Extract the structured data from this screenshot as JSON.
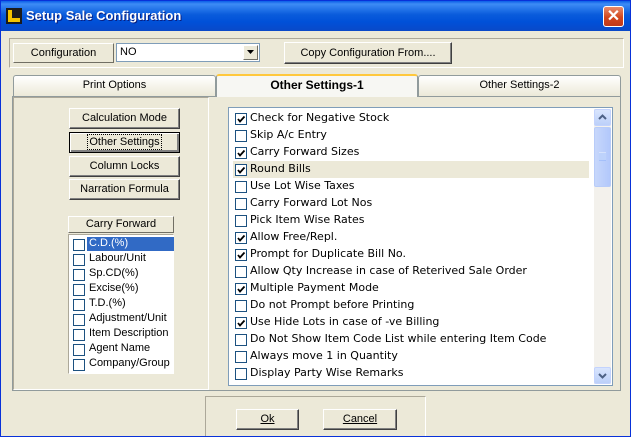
{
  "window": {
    "title": "Setup Sale Configuration"
  },
  "config": {
    "label": "Configuration",
    "value": "NO",
    "copy_button": "Copy Configuration From...."
  },
  "tabs": [
    {
      "label": "Print Options"
    },
    {
      "label": "Other Settings-1"
    },
    {
      "label": "Other Settings-2"
    }
  ],
  "left_buttons": {
    "calculation_mode": "Calculation Mode",
    "other_settings": "Other Settings",
    "column_locks": "Column Locks",
    "narration_formula": "Narration Formula"
  },
  "carry_forward": {
    "header": "Carry Forward",
    "items": [
      {
        "label": "C.D.(%)",
        "checked": false,
        "selected": true
      },
      {
        "label": "Labour/Unit",
        "checked": false
      },
      {
        "label": "Sp.CD(%)",
        "checked": false
      },
      {
        "label": "Excise(%)",
        "checked": false
      },
      {
        "label": "T.D.(%)",
        "checked": false
      },
      {
        "label": "Adjustment/Unit",
        "checked": false
      },
      {
        "label": "Item Description",
        "checked": false
      },
      {
        "label": "Agent Name",
        "checked": false
      },
      {
        "label": "Company/Group",
        "checked": false
      }
    ]
  },
  "options": [
    {
      "label": "Check for Negative Stock",
      "checked": true
    },
    {
      "label": "Skip A/c Entry",
      "checked": false
    },
    {
      "label": "Carry Forward Sizes",
      "checked": true
    },
    {
      "label": "Round Bills",
      "checked": true,
      "selected": true
    },
    {
      "label": "Use Lot Wise Taxes",
      "checked": false
    },
    {
      "label": "Carry Forward Lot Nos",
      "checked": false
    },
    {
      "label": "Pick Item Wise Rates",
      "checked": false
    },
    {
      "label": "Allow Free/Repl.",
      "checked": true
    },
    {
      "label": "Prompt for Duplicate Bill No.",
      "checked": true
    },
    {
      "label": "Allow Qty Increase in case of Reterived Sale Order",
      "checked": false
    },
    {
      "label": "Multiple Payment Mode",
      "checked": true
    },
    {
      "label": "Do not Prompt before Printing",
      "checked": false
    },
    {
      "label": "Use Hide Lots in case of -ve Billing",
      "checked": true
    },
    {
      "label": "Do Not Show Item Code List while entering Item Code",
      "checked": false
    },
    {
      "label": "Always move 1 in Quantity",
      "checked": false
    },
    {
      "label": "Display Party Wise Remarks",
      "checked": false
    }
  ],
  "footer": {
    "ok": "Ok",
    "cancel": "Cancel"
  },
  "colors": {
    "title_blue": "#0054e3",
    "close_red": "#d2461c",
    "dialog_bg": "#ece9d8",
    "active_tab_accent": "#ffc83c",
    "list_selection": "#316ac5"
  }
}
